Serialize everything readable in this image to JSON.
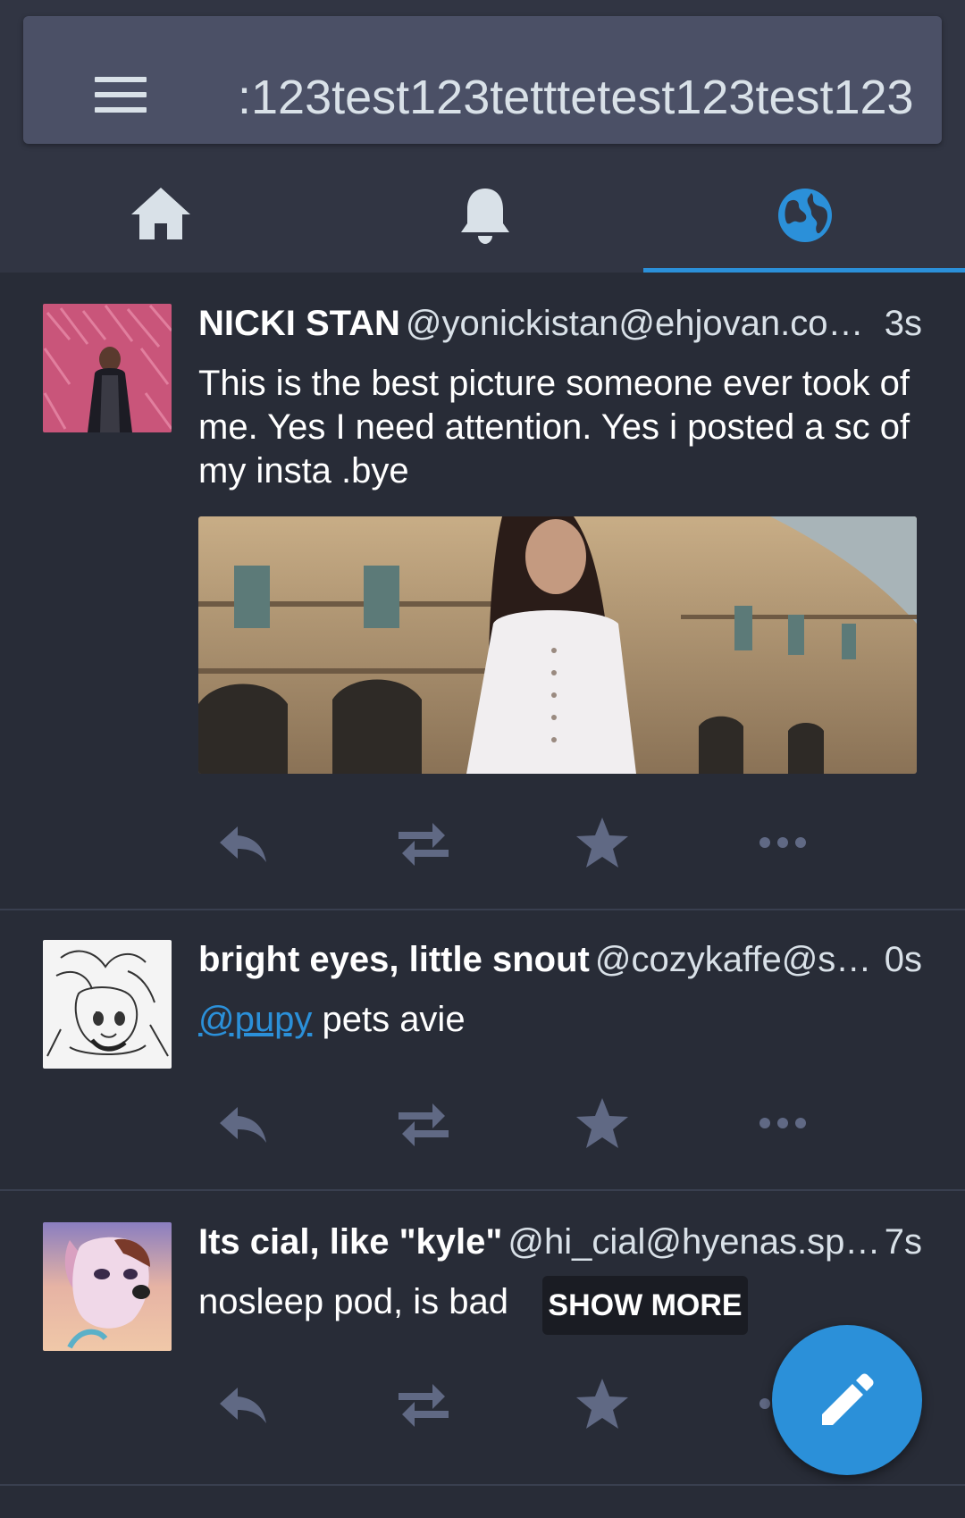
{
  "search": {
    "value": ":123test123tetttetest123test123"
  },
  "tabs": [
    {
      "name": "home",
      "icon": "home-icon",
      "active": false
    },
    {
      "name": "notifications",
      "icon": "bell-icon",
      "active": false
    },
    {
      "name": "federated",
      "icon": "globe-icon",
      "active": true
    }
  ],
  "colors": {
    "accent": "#2b90d9",
    "background": "#282c37",
    "action_icon": "#606984"
  },
  "statuses": [
    {
      "display_name": "NICKI STAN",
      "handle": "@yonickistan@ehjovan.co…",
      "time": "3s",
      "content": "This is the best picture someone ever took of me. Yes I need attention. Yes i posted a sc of my insta .bye",
      "has_media": true
    },
    {
      "display_name": "bright eyes, little snout",
      "handle": "@cozykaffe@s…",
      "time": "0s",
      "mention": "@pupy",
      "content": "pets avie"
    },
    {
      "display_name": "Its cial, like \"kyle\"",
      "handle": "@hi_cial@hyenas.sp…",
      "time": "7s",
      "content": "nosleep pod, is bad",
      "show_more_label": "SHOW MORE"
    }
  ],
  "actions": [
    "reply-icon",
    "boost-icon",
    "favourite-icon",
    "more-icon"
  ],
  "fab": {
    "icon": "pencil-icon"
  }
}
